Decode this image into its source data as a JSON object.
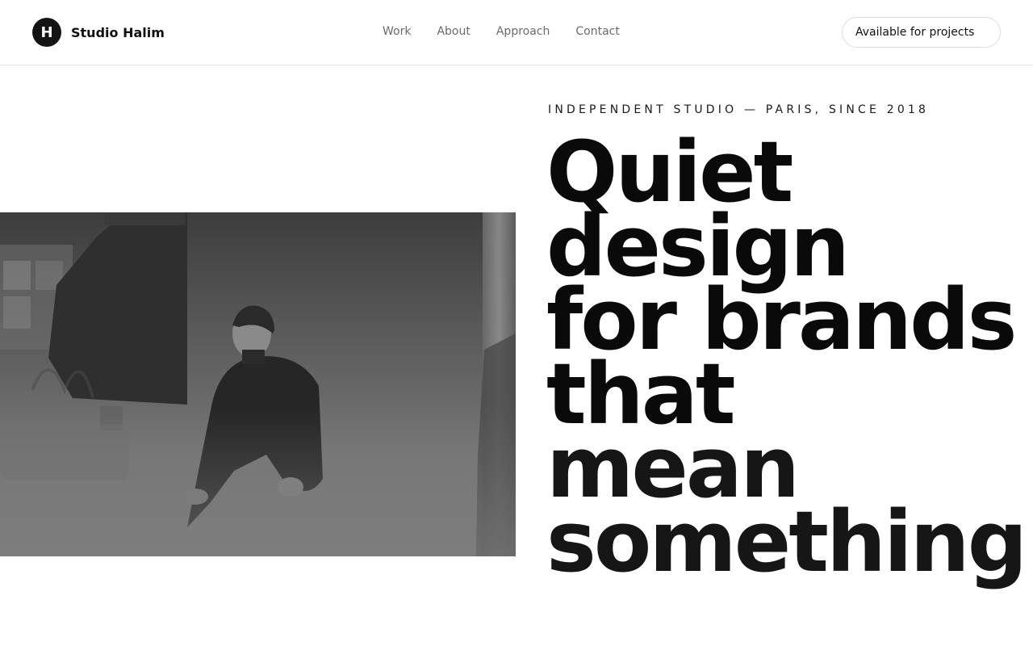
{
  "header": {
    "logo_letter": "H",
    "brand_name": "Studio Halim",
    "nav": [
      "Work",
      "About",
      "Approach",
      "Contact"
    ],
    "cta_label": "Available for projects"
  },
  "hero": {
    "eyebrow": "INDEPENDENT STUDIO — PARIS, SINCE 2018",
    "headline_lines": [
      "Quiet",
      "design",
      "for brands",
      "that",
      "mean",
      "something."
    ],
    "photo_icon": "portrait-photo"
  },
  "colors": {
    "ink": "#0a0a0a",
    "muted_nav": "#6b6b6b",
    "border": "#e6e6e6",
    "logo_bg": "#141414"
  }
}
